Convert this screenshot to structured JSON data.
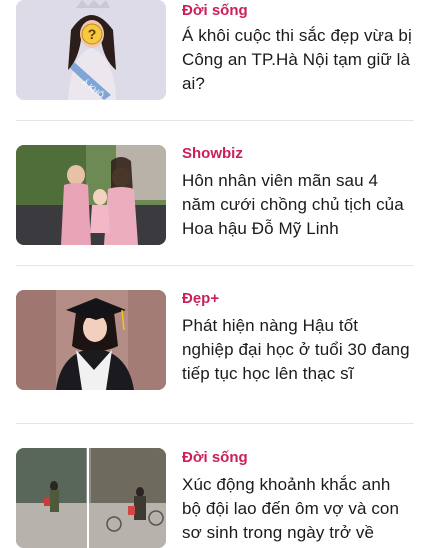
{
  "articles": [
    {
      "category": "Đời sống",
      "title": "Á khôi cuộc thi sắc đẹp vừa bị Công an TP.Hà Nội tạm giữ là ai?",
      "image_icon": "question-mark-icon",
      "image_sash_text": "Á KHÔ"
    },
    {
      "category": "Showbiz",
      "title": "Hôn nhân viên mãn sau 4 năm cưới chồng chủ tịch của Hoa hậu Đỗ Mỹ Linh"
    },
    {
      "category": "Đẹp+",
      "title": "Phát hiện nàng Hậu tốt nghiệp đại học ở tuổi 30 đang tiếp tục học lên thạc sĩ"
    },
    {
      "category": "Đời sống",
      "title": "Xúc động khoảnh khắc anh bộ đội lao đến ôm vợ và con sơ sinh trong ngày trở về"
    }
  ],
  "colors": {
    "category": "#cc1f57",
    "title": "#1b1b1b",
    "divider": "#e6e6e6"
  }
}
